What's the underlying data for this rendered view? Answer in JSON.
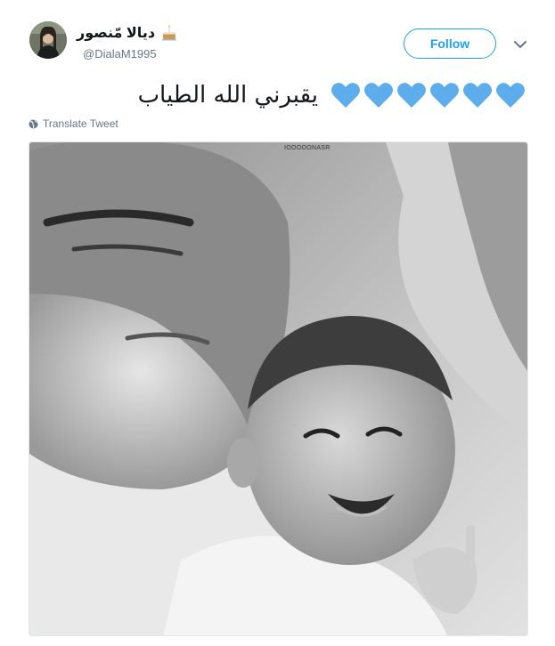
{
  "user": {
    "display_name": "ديالا مّنصور",
    "handle": "@DialaM1995",
    "name_emoji": "cake-icon"
  },
  "actions": {
    "follow_label": "Follow",
    "more_icon": "chevron-down-icon"
  },
  "tweet": {
    "text": "يقبرني الله الطياب",
    "hearts": [
      "blue-heart-icon",
      "blue-heart-icon",
      "blue-heart-icon",
      "blue-heart-icon",
      "blue-heart-icon",
      "blue-heart-icon"
    ],
    "heart_color": "#5dadec",
    "translate_label": "Translate Tweet"
  },
  "media": {
    "watermark": "IOOOOONASR"
  },
  "colors": {
    "accent": "#1da1f2",
    "secondary_text": "#657786"
  }
}
